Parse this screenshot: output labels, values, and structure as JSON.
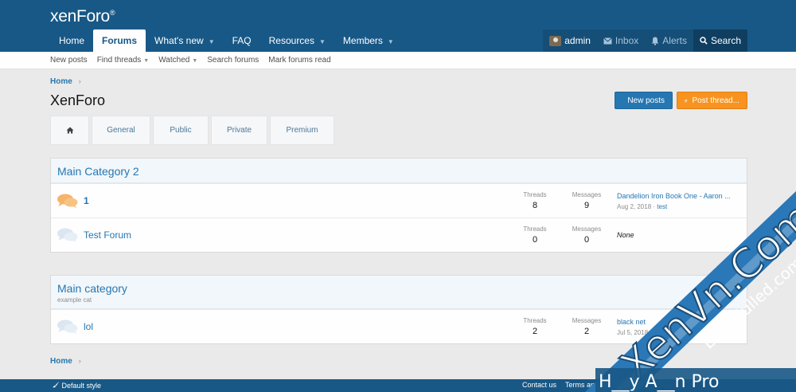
{
  "header": {
    "logo_text": "xenForo",
    "logo_mark": "®",
    "nav": [
      {
        "label": "Home",
        "caret": ""
      },
      {
        "label": "Forums",
        "caret": ""
      },
      {
        "label": "What's new",
        "caret": "▼"
      },
      {
        "label": "FAQ",
        "caret": ""
      },
      {
        "label": "Resources",
        "caret": "▼"
      },
      {
        "label": "Members",
        "caret": "▼"
      }
    ],
    "user": {
      "name": "admin",
      "inbox": "Inbox",
      "alerts": "Alerts",
      "search": "Search"
    }
  },
  "subnav": [
    {
      "label": "New posts",
      "caret": ""
    },
    {
      "label": "Find threads",
      "caret": "▼"
    },
    {
      "label": "Watched",
      "caret": "▼"
    },
    {
      "label": "Search forums",
      "caret": ""
    },
    {
      "label": "Mark forums read",
      "caret": ""
    }
  ],
  "breadcrumb": {
    "home": "Home",
    "chevron": "›"
  },
  "page_title": "XenForo",
  "buttons": {
    "new_posts": "New posts",
    "post_thread": "Post thread..."
  },
  "tabs": [
    "General",
    "Public",
    "Private",
    "Premium"
  ],
  "categories": [
    {
      "title": "Main Category 2",
      "description": "",
      "forums": [
        {
          "name": "1",
          "threads": "8",
          "messages": "9",
          "last_title": "Dandelion Iron Book One - Aaron ...",
          "last_date": "Aug 2, 2018",
          "last_user": "test",
          "unread": true
        },
        {
          "name": "Test Forum",
          "threads": "0",
          "messages": "0",
          "last_title": "",
          "last_none": "None",
          "unread": false
        }
      ]
    },
    {
      "title": "Main category",
      "description": "example cat",
      "forums": [
        {
          "name": "lol",
          "threads": "2",
          "messages": "2",
          "last_title": "black net",
          "last_date": "Jul 5, 2018",
          "last_user": "",
          "unread": false
        }
      ]
    }
  ],
  "stat_labels": {
    "threads": "Threads",
    "messages": "Messages"
  },
  "footer": {
    "style": "Default style",
    "links": [
      "Contact us",
      "Terms an"
    ]
  },
  "watermark": {
    "main": "XenVn.Com",
    "sub": "LoveNulled.com",
    "bottom": "H__y A__n Pro"
  },
  "colors": {
    "brand": "#185886",
    "link": "#2577b1",
    "accent": "#f7931e"
  }
}
